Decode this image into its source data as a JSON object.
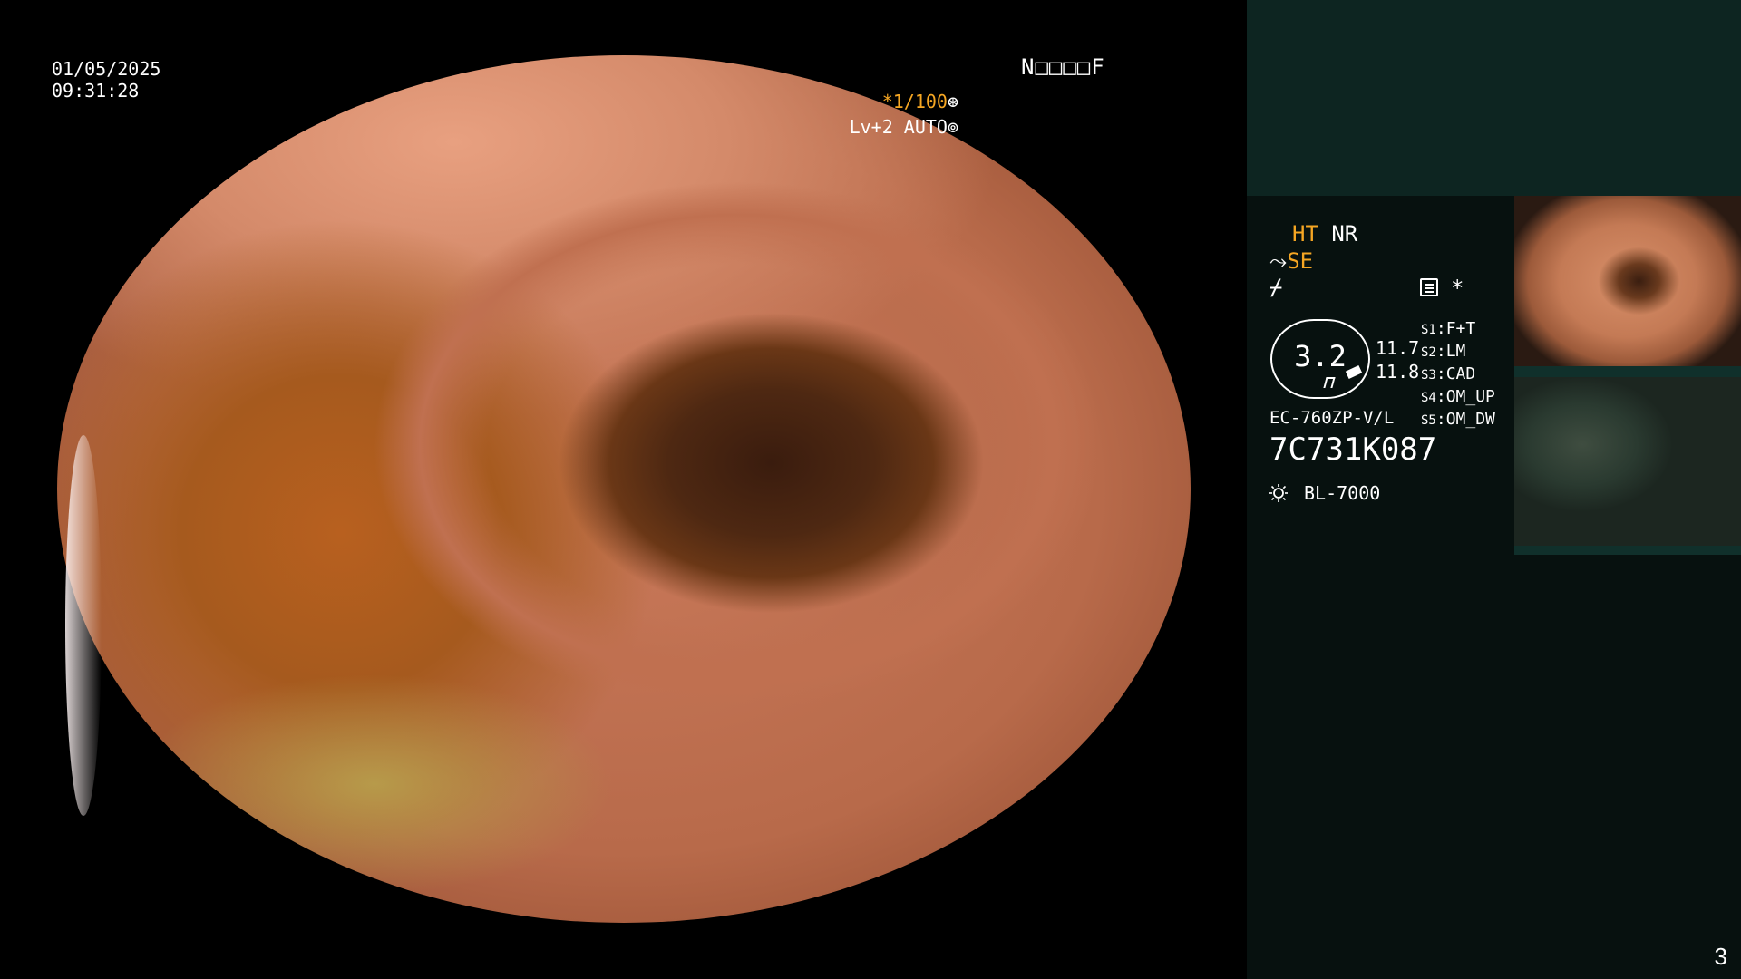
{
  "overlay": {
    "date": "01/05/2025",
    "time": "09:31:28",
    "patient_id": "N□□□□F",
    "shutter": "*1/100",
    "shutter_icon": "aperture-icon",
    "level": "Lv+2 AUTO",
    "level_icon": "iris-icon"
  },
  "panel": {
    "ht": "HT",
    "nr": "NR",
    "se": "SE",
    "zoom": "3.2",
    "val1": "11.7",
    "val2": "11.8",
    "switches": [
      {
        "key": "S1",
        "value": "F+T"
      },
      {
        "key": "S2",
        "value": "LM"
      },
      {
        "key": "S3",
        "value": "CAD"
      },
      {
        "key": "S4",
        "value": "OM_UP"
      },
      {
        "key": "S5",
        "value": "OM_DW"
      }
    ],
    "scope_model": "EC-760ZP-V/L",
    "scope_serial": "7C731K087",
    "light_source": "BL-7000",
    "star": "*"
  },
  "page_number": "3",
  "colors": {
    "panel_bg": "#07110f",
    "panel_top": "#0d2521",
    "accent": "#f5a623"
  }
}
